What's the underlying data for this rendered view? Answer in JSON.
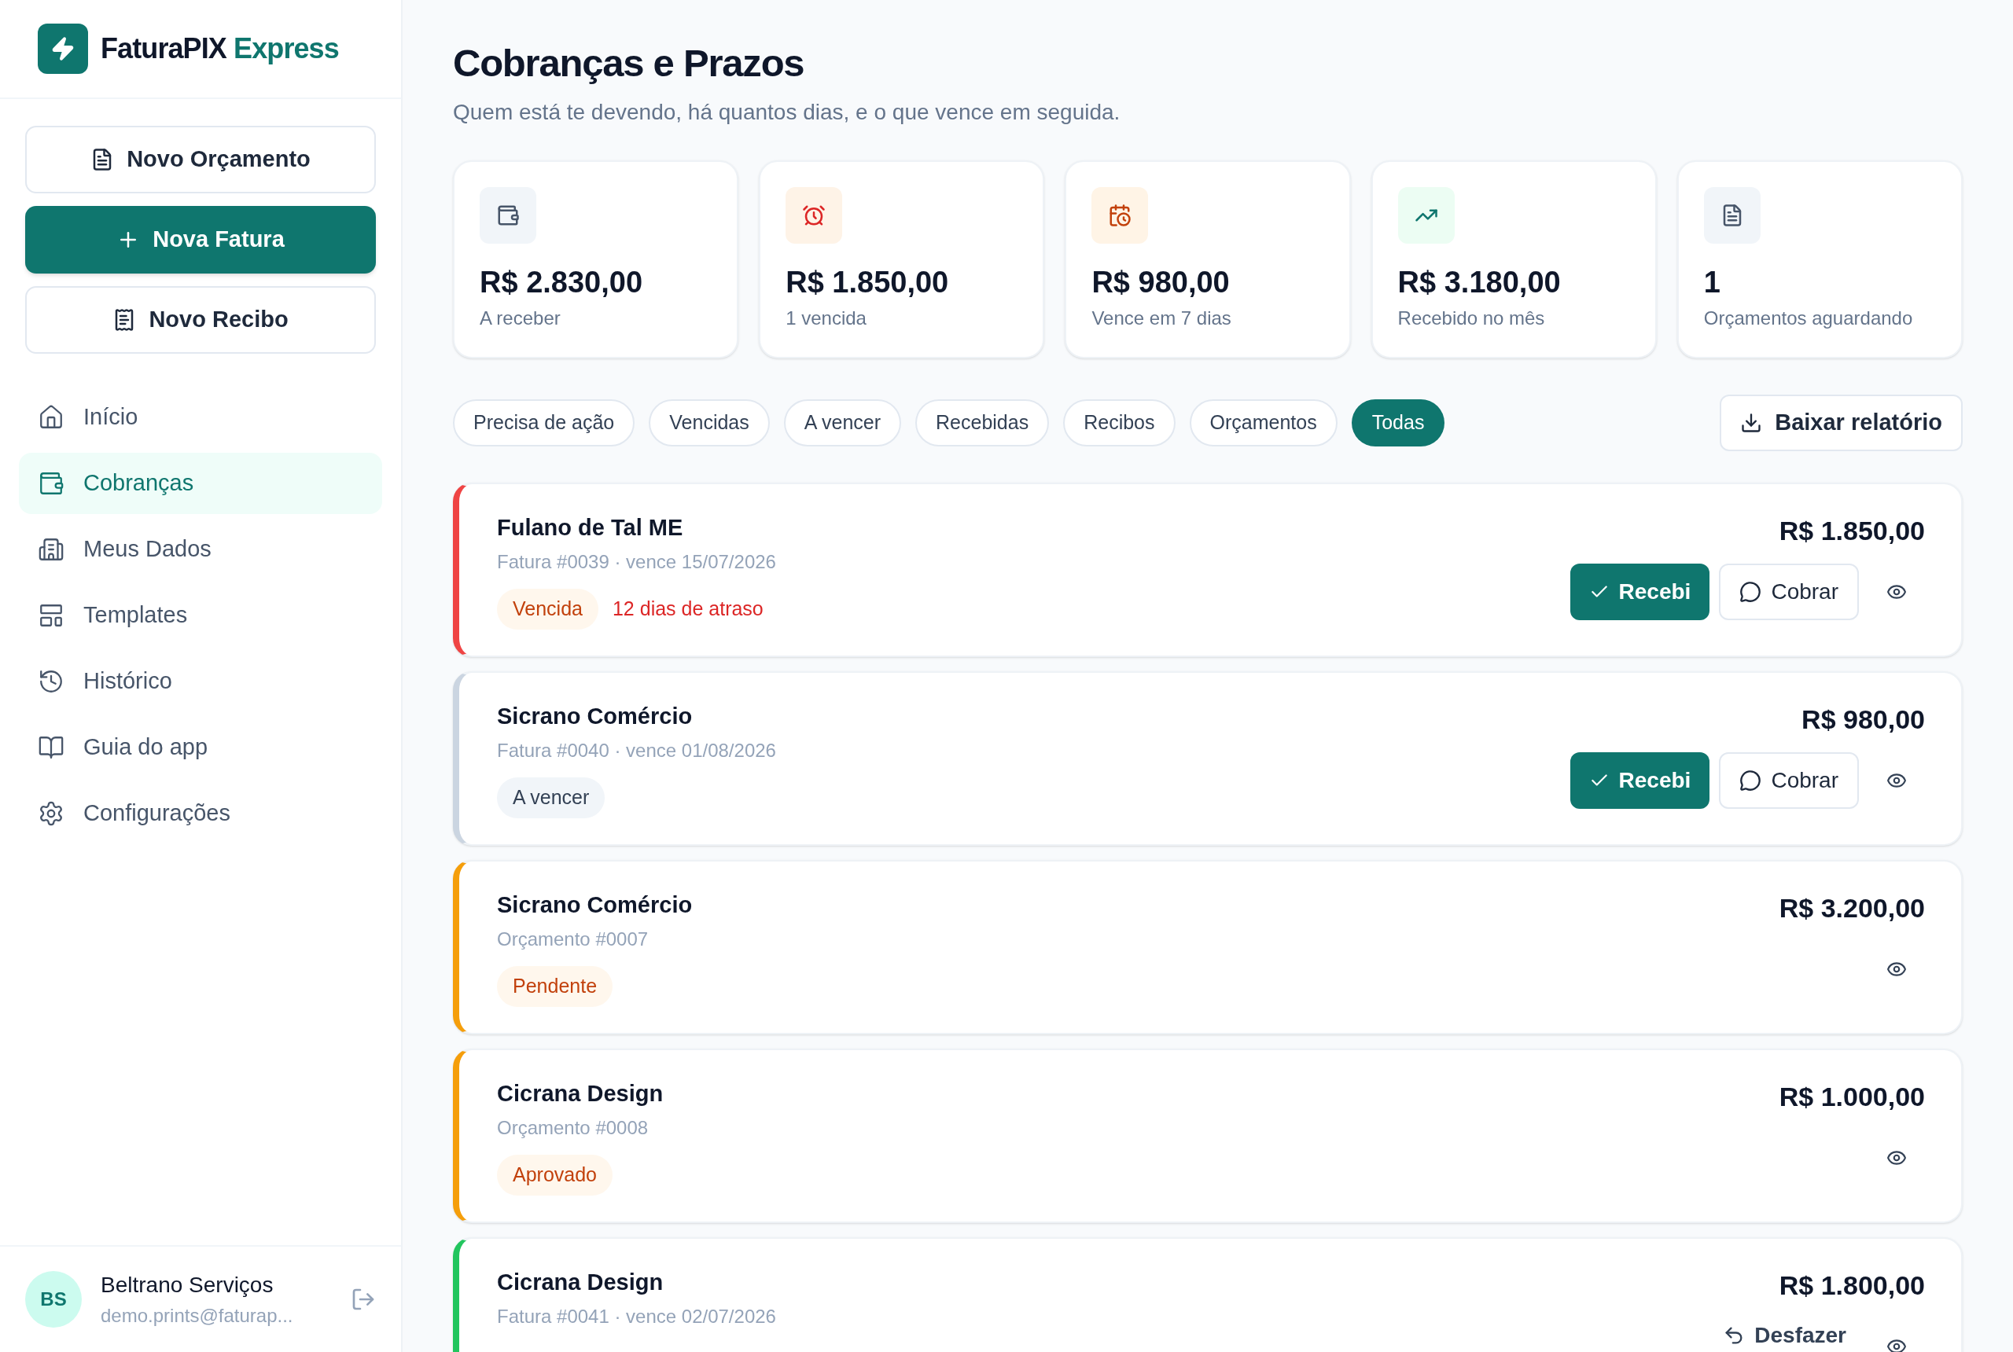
{
  "sidebar": {
    "brand": {
      "name": "FaturaPIX",
      "accent": "Express"
    },
    "actions": [
      {
        "label": "Novo Orçamento",
        "kind": "outline"
      },
      {
        "label": "Nova Fatura",
        "kind": "primary"
      },
      {
        "label": "Novo Recibo",
        "kind": "outline"
      }
    ],
    "nav": [
      {
        "label": "Início",
        "selected": false
      },
      {
        "label": "Cobranças",
        "selected": true
      },
      {
        "label": "Meus Dados",
        "selected": false
      },
      {
        "label": "Templates",
        "selected": false
      },
      {
        "label": "Histórico",
        "selected": false
      },
      {
        "label": "Guia do app",
        "selected": false
      },
      {
        "label": "Configurações",
        "selected": false
      }
    ],
    "user": {
      "initials": "BS",
      "name": "Beltrano Serviços",
      "email": "demo.prints@faturap..."
    }
  },
  "page": {
    "title": "Cobranças e Prazos",
    "subtitle": "Quem está te devendo, há quantos dias, e o que vence em seguida."
  },
  "stats": [
    {
      "value": "R$ 2.830,00",
      "label": "A receber",
      "kind": "neutral"
    },
    {
      "value": "R$ 1.850,00",
      "label": "1 vencida",
      "kind": "red"
    },
    {
      "value": "R$ 980,00",
      "label": "Vence em 7 dias",
      "kind": "orange"
    },
    {
      "value": "R$ 3.180,00",
      "label": "Recebido no mês",
      "kind": "green"
    },
    {
      "value": "1",
      "label": "Orçamentos aguardando",
      "kind": "neutral"
    }
  ],
  "filters": [
    {
      "label": "Precisa de ação",
      "selected": false
    },
    {
      "label": "Vencidas",
      "selected": false
    },
    {
      "label": "A vencer",
      "selected": false
    },
    {
      "label": "Recebidas",
      "selected": false
    },
    {
      "label": "Recibos",
      "selected": false
    },
    {
      "label": "Orçamentos",
      "selected": false
    },
    {
      "label": "Todas",
      "selected": true
    }
  ],
  "report_button": "Baixar relatório",
  "items": [
    {
      "name": "Fulano de Tal ME",
      "ref": "Fatura #0039 · vence 15/07/2026",
      "amount": "R$ 1.850,00",
      "color": "#ef4444",
      "badges": [
        {
          "label": "Vencida",
          "kind": "warn"
        }
      ],
      "note": "12 dias de atraso",
      "actions": [
        {
          "kind": "received",
          "label": "Recebi"
        },
        {
          "kind": "charge",
          "label": "Cobrar"
        },
        {
          "kind": "view"
        }
      ]
    },
    {
      "name": "Sicrano Comércio",
      "ref": "Fatura #0040 · vence 01/08/2026",
      "amount": "R$ 980,00",
      "color": "#cbd5e1",
      "badges": [
        {
          "label": "A vencer",
          "kind": "neutral"
        }
      ],
      "actions": [
        {
          "kind": "received",
          "label": "Recebi"
        },
        {
          "kind": "charge",
          "label": "Cobrar"
        },
        {
          "kind": "view"
        }
      ]
    },
    {
      "name": "Sicrano Comércio",
      "ref": "Orçamento #0007",
      "amount": "R$ 3.200,00",
      "color": "#f59e0b",
      "badges": [
        {
          "label": "Pendente",
          "kind": "warn"
        }
      ],
      "actions": [
        {
          "kind": "view"
        }
      ]
    },
    {
      "name": "Cicrana Design",
      "ref": "Orçamento #0008",
      "amount": "R$ 1.000,00",
      "color": "#f59e0b",
      "badges": [
        {
          "label": "Aprovado",
          "kind": "warn"
        }
      ],
      "actions": [
        {
          "kind": "view"
        }
      ]
    },
    {
      "name": "Cicrana Design",
      "ref": "Fatura #0041 · vence 02/07/2026",
      "amount": "R$ 1.800,00",
      "color": "#22c55e",
      "actions": [
        {
          "kind": "undo",
          "label": "Desfazer"
        },
        {
          "kind": "view"
        }
      ]
    }
  ]
}
